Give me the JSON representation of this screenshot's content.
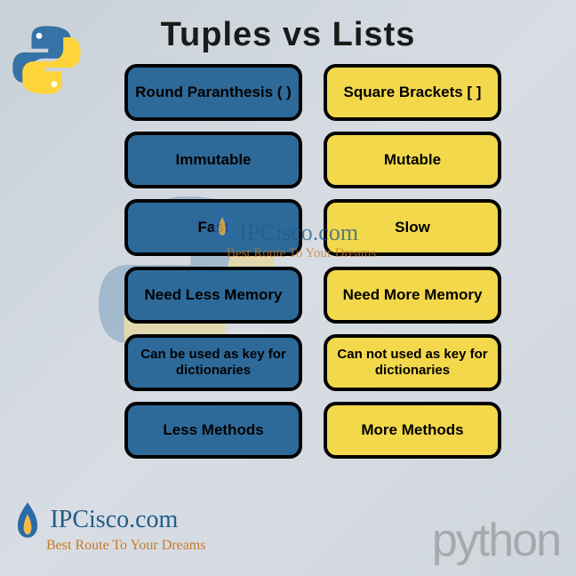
{
  "title": "Tuples  vs  Lists",
  "rows": [
    {
      "tuple": "Round Paranthesis ( )",
      "list": "Square Brackets [ ]"
    },
    {
      "tuple": "Immutable",
      "list": "Mutable"
    },
    {
      "tuple": "Fast",
      "list": "Slow"
    },
    {
      "tuple": "Need Less Memory",
      "list": "Need More Memory"
    },
    {
      "tuple": "Can be used as key for dictionaries",
      "list": "Can not used as key for dictionaries"
    },
    {
      "tuple": "Less Methods",
      "list": "More Methods"
    }
  ],
  "watermark": {
    "brand": "IPCisco.com",
    "slogan": "Best Route To Your Dreams"
  },
  "footer": {
    "brand": "IPCisco.com",
    "slogan": "Best Route To Your Dreams",
    "python_text": "python"
  }
}
